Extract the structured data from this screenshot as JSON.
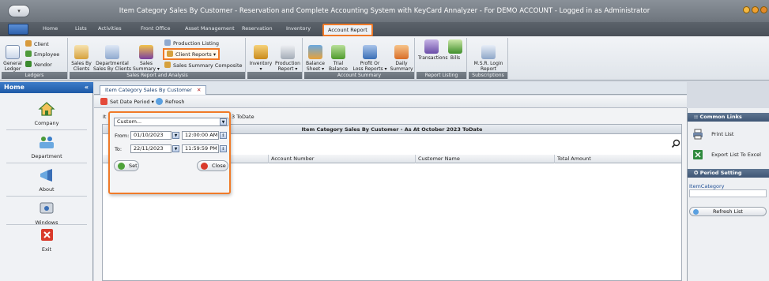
{
  "window": {
    "title": "Item Category Sales By Customer - Reservation and Complete Accounting System with KeyCard Annalyzer - For DEMO ACCOUNT - Logged in as Administrator"
  },
  "ribbon_tabs": [
    "Home",
    "Lists",
    "Activities",
    "Front Office",
    "Asset Management",
    "Reservation",
    "Inventory",
    "Account Report"
  ],
  "ribbon": {
    "ledgers": {
      "label": "Ledgers",
      "general_ledger": "General\nLedger",
      "client": "Client",
      "employee": "Employee",
      "vendor": "Vendor"
    },
    "sales": {
      "label": "Sales Report and Analysis",
      "sales_by_clients": "Sales By\nClients",
      "departmental": "Departmental\nSales By Clients",
      "sales_summary": "Sales\nSummary ▾",
      "production_listing": "Production Listing",
      "client_reports": "Client Reports ▾",
      "sales_summary_composite": "Sales Summary Composite"
    },
    "inventory": {
      "inventory": "Inventory\n▾",
      "production_report": "Production\nReport ▾"
    },
    "account_summary": {
      "label": "Account Summary",
      "balance_sheet": "Balance\nSheet ▾",
      "trial_balance": "Trial\nBalance ▾",
      "profit_or_loss": "Profit Or\nLoss Reports ▾",
      "daily_summary": "Daily\nSummary"
    },
    "report_listing": {
      "label": "Report Listing",
      "transactions": "Transactions",
      "bills": "Bills"
    },
    "subscriptions": {
      "label": "Subscriptions",
      "msr_login": "M.S.R. Login\nReport"
    }
  },
  "left_panel": {
    "title": "Home",
    "collapse": "«",
    "items": [
      "Company",
      "Department",
      "About",
      "Windows",
      "Exit"
    ]
  },
  "doc_tab": {
    "label": "Item Category Sales By Customer",
    "close": "✕"
  },
  "toolbar": {
    "set_date_period": "Set Date Period ▾",
    "refresh": "Refresh"
  },
  "partial_label": "It",
  "header_suffix": "3 ToDate",
  "report": {
    "title": "Item Category Sales By Customer - As At October 2023 ToDate",
    "columns": [
      "Account Number",
      "Customer Name",
      "Total Amount"
    ]
  },
  "popup": {
    "preset": "Custom...",
    "from_label": "From:",
    "from_date": "01/10/2023",
    "from_time": "12:00:00 AM",
    "to_label": "To:",
    "to_date": "22/11/2023",
    "to_time": "11:59:59 PM",
    "set": "Set",
    "close": "Close"
  },
  "right_panel": {
    "common_links": ":: Common Links",
    "print_list": "Print List",
    "export_excel": "Export List To Excel",
    "period_setting": "✪ Period Setting",
    "item_category": "ItemCategory",
    "refresh_list": "Refresh List"
  },
  "colors": {
    "accent_orange": "#f07a28",
    "header_blue": "#1f5aa6"
  }
}
